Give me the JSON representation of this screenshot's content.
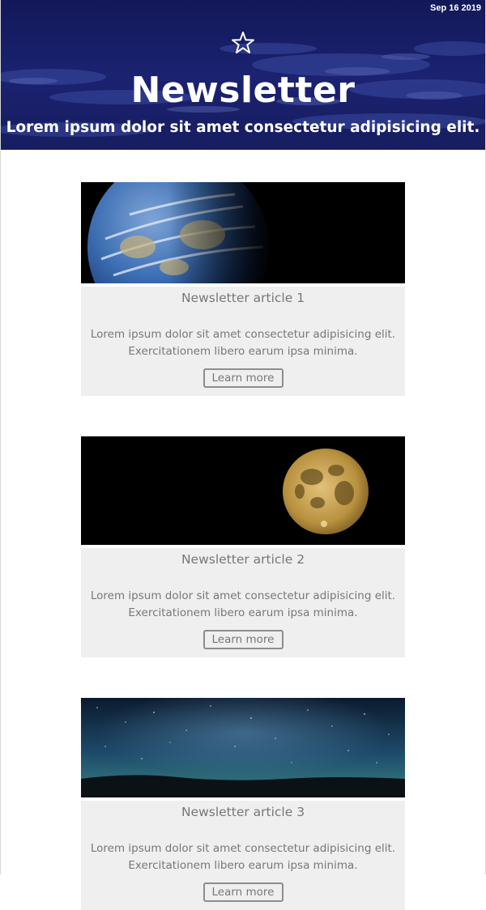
{
  "header": {
    "date": "Sep 16 2019",
    "title": "Newsletter",
    "subtitle": "Lorem ipsum dolor sit amet consectetur adipisicing elit.",
    "icon": "star-icon"
  },
  "articles": [
    {
      "title": "Newsletter article 1",
      "body_line1": "Lorem ipsum dolor sit amet consectetur adipisicing elit.",
      "body_line2": "Exercitationem libero earum ipsa minima.",
      "button": "Learn more",
      "image": "earth-image"
    },
    {
      "title": "Newsletter article 2",
      "body_line1": "Lorem ipsum dolor sit amet consectetur adipisicing elit.",
      "body_line2": "Exercitationem libero earum ipsa minima.",
      "button": "Learn more",
      "image": "moon-image"
    },
    {
      "title": "Newsletter article 3",
      "body_line1": "Lorem ipsum dolor sit amet consectetur adipisicing elit.",
      "body_line2": "Exercitationem libero earum ipsa minima.",
      "button": "Learn more",
      "image": "night-sky-image"
    }
  ],
  "colors": {
    "header_bg": "#1a2066",
    "card_bg": "#efefef",
    "text_gray": "#777777"
  }
}
